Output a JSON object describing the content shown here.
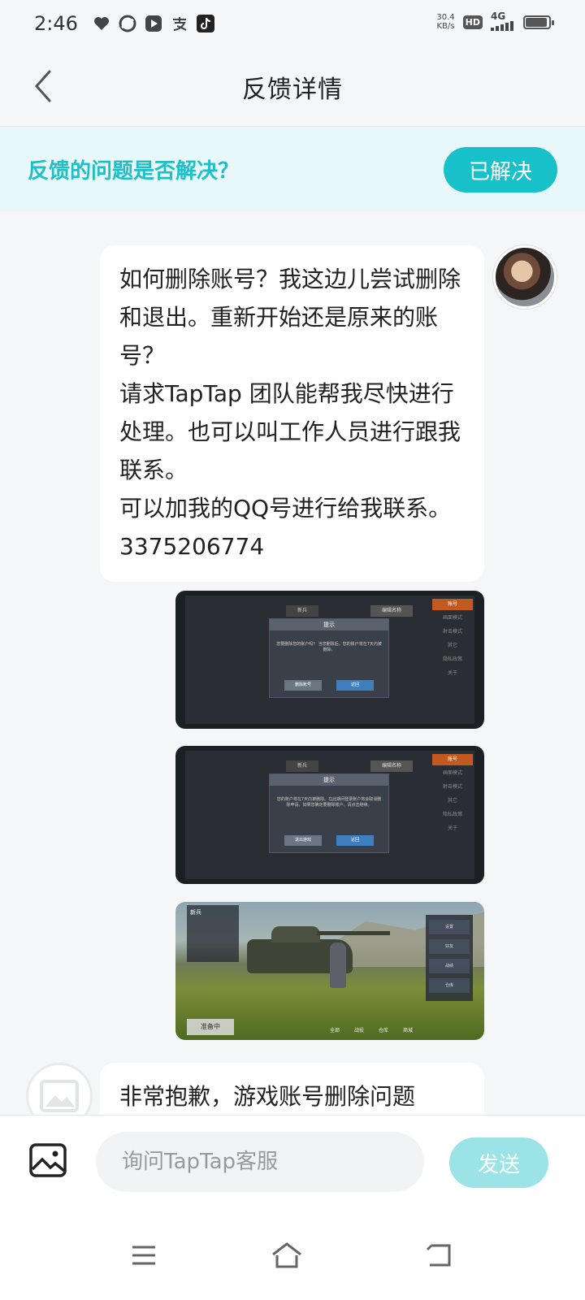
{
  "status_bar": {
    "time": "2:46",
    "speed_value": "30.4",
    "speed_unit": "KB/s",
    "hd": "HD",
    "network": "4G",
    "icons": [
      "heart-icon",
      "sync-icon",
      "video-icon",
      "alipay-icon",
      "tiktok-icon"
    ]
  },
  "header": {
    "title": "反馈详情"
  },
  "banner": {
    "question": "反馈的问题是否解决？",
    "resolved_label": "已解决",
    "accent_color": "#18c1c9"
  },
  "messages": {
    "user_text": "如何删除账号？我这边儿尝试删除和退出。重新开始还是原来的账号？\n请求TapTap 团队能帮我尽快进行处理。也可以叫工作人员进行跟我联系。\n可以加我的QQ号进行给我联系。3375206774",
    "agent_text": "非常抱歉，游戏账号删除问题",
    "screenshot_1": {
      "dialog_title": "提示",
      "dialog_text": "您要删除您的账户吗？ 当您删除后，您的账户将在7天内被删除。",
      "button_a": "删除账号",
      "button_b": "返回",
      "name_box": "编辑名称",
      "rank": "新兵",
      "side_items": [
        "账号",
        "画面模式",
        "射击模式",
        "其它",
        "隐私政策",
        "关于"
      ]
    },
    "screenshot_2": {
      "dialog_title": "提示",
      "dialog_text": "您的账户将在7天内被删除。在此期间登录账户将会取消删除申请，如果您确定要删除账户，请点击继续。",
      "button_a": "退出游戏",
      "button_b": "返回",
      "name_box": "编辑名称",
      "rank": "新兵",
      "side_items": [
        "账号",
        "画面模式",
        "射击模式",
        "其它",
        "隐私政策",
        "关于"
      ]
    },
    "screenshot_3": {
      "ready_label": "准备中",
      "rank": "新兵",
      "panel_items": [
        "设置",
        "好友",
        "战绩",
        "仓库"
      ],
      "bottom_items": [
        "全部",
        "战役",
        "仓库",
        "商城"
      ]
    }
  },
  "input_bar": {
    "placeholder": "询问TapTap客服",
    "send_label": "发送"
  }
}
